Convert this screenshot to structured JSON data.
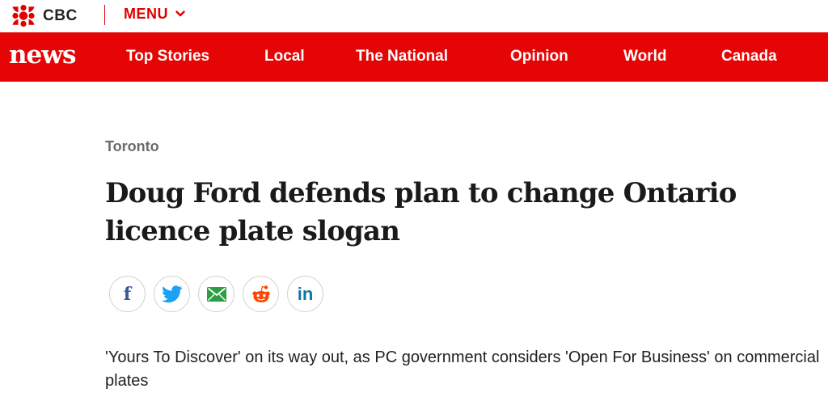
{
  "header": {
    "logo_text": "CBC",
    "menu_label": "MENU"
  },
  "navbar": {
    "brand": "news",
    "items": [
      {
        "label": "Top Stories"
      },
      {
        "label": "Local"
      },
      {
        "label": "The National"
      },
      {
        "label": "Opinion"
      },
      {
        "label": "World"
      },
      {
        "label": "Canada"
      }
    ],
    "background_color": "#e60505"
  },
  "article": {
    "section": "Toronto",
    "headline": "Doug Ford defends plan to change Ontario licence plate slogan",
    "deck": "'Yours To Discover' on its way out, as PC government considers 'Open For Business' on commercial plates"
  },
  "share": [
    {
      "icon": "facebook-icon",
      "glyph": "f"
    },
    {
      "icon": "twitter-icon"
    },
    {
      "icon": "email-icon"
    },
    {
      "icon": "reddit-icon"
    },
    {
      "icon": "linkedin-icon",
      "glyph": "in"
    }
  ],
  "colors": {
    "accent": "#e00000",
    "section_text": "#6b6b6b",
    "facebook": "#3b5998",
    "twitter": "#1da1f2",
    "email": "#2e9e44",
    "reddit": "#ff4500",
    "linkedin": "#0e76a8"
  }
}
